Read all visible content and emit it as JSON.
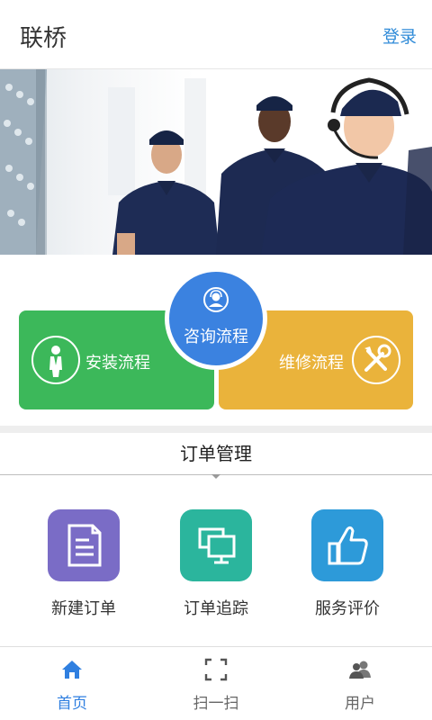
{
  "header": {
    "title": "联桥",
    "login_label": "登录"
  },
  "process": {
    "consult_label": "咨询流程",
    "install_label": "安装流程",
    "repair_label": "维修流程"
  },
  "orders": {
    "section_title": "订单管理",
    "items": [
      {
        "label": "新建订单",
        "icon": "document-icon",
        "color": "#7a6cc6"
      },
      {
        "label": "订单追踪",
        "icon": "monitor-icon",
        "color": "#2bb59d"
      },
      {
        "label": "服务评价",
        "icon": "thumbs-up-icon",
        "color": "#2d9ad9"
      }
    ]
  },
  "tabs": [
    {
      "label": "首页",
      "icon": "home-icon",
      "active": true
    },
    {
      "label": "扫一扫",
      "icon": "scan-icon",
      "active": false
    },
    {
      "label": "用户",
      "icon": "user-group-icon",
      "active": false
    }
  ],
  "colors": {
    "accent": "#2f7fe0",
    "green": "#3cb85a",
    "orange": "#eab33b",
    "blue": "#3b82e0"
  }
}
